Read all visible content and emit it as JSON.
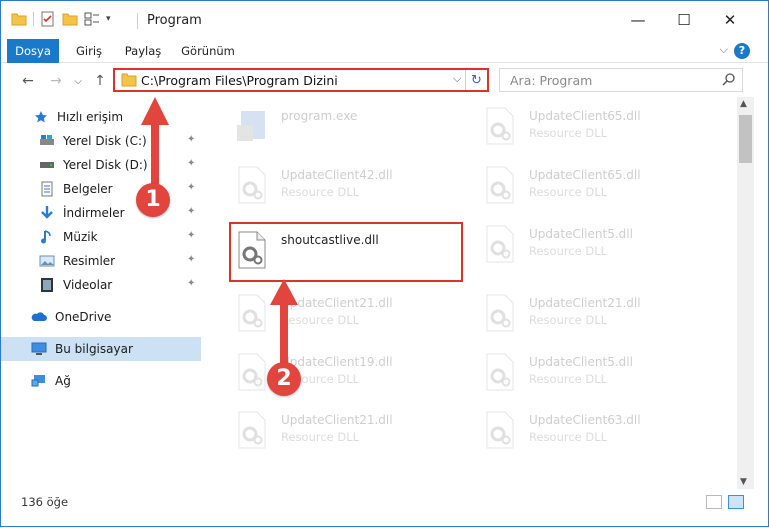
{
  "window": {
    "title": "Program",
    "controls": {
      "minimize": "—",
      "maximize": "☐",
      "close": "✕"
    }
  },
  "ribbon": {
    "tabs": [
      "Dosya",
      "Giriş",
      "Paylaş",
      "Görünüm"
    ],
    "help": "?"
  },
  "address": {
    "path": "C:\\Program Files\\Program Dizini",
    "dropdown": "⌵",
    "refresh": "↻"
  },
  "search": {
    "placeholder": "Ara: Program"
  },
  "nav": {
    "back": "←",
    "forward": "→",
    "down": "⌵",
    "up": "↑",
    "items": [
      {
        "label": "Hızlı erişim",
        "icon": "star-icon"
      },
      {
        "label": "Yerel Disk (C:)",
        "icon": "disk-icon",
        "pinned": true
      },
      {
        "label": "Yerel Disk (D:)",
        "icon": "disk-icon",
        "pinned": true
      },
      {
        "label": "Belgeler",
        "icon": "documents-icon",
        "pinned": true
      },
      {
        "label": "İndirmeler",
        "icon": "downloads-icon",
        "pinned": true
      },
      {
        "label": "Müzik",
        "icon": "music-icon",
        "pinned": true
      },
      {
        "label": "Resimler",
        "icon": "pictures-icon",
        "pinned": true
      },
      {
        "label": "Videolar",
        "icon": "videos-icon",
        "pinned": true
      },
      {
        "label": "OneDrive",
        "icon": "cloud-icon"
      },
      {
        "label": "Bu bilgisayar",
        "icon": "computer-icon"
      },
      {
        "label": "Ağ",
        "icon": "network-icon"
      }
    ],
    "pin": "✦"
  },
  "files": {
    "left": [
      {
        "name": "program.exe",
        "type": ""
      },
      {
        "name": "UpdateClient42.dll",
        "type": "Resource DLL"
      },
      {
        "name": "shoutcastlive.dll",
        "type": ""
      },
      {
        "name": "UpdateClient21.dll",
        "type": "Resource DLL"
      },
      {
        "name": "UpdateClient19.dll",
        "type": "Resource DLL"
      },
      {
        "name": "UpdateClient21.dll",
        "type": "Resource DLL"
      }
    ],
    "right": [
      {
        "name": "UpdateClient65.dll",
        "type": "Resource DLL"
      },
      {
        "name": "UpdateClient65.dll",
        "type": "Resource DLL"
      },
      {
        "name": "UpdateClient5.dll",
        "type": "Resource DLL"
      },
      {
        "name": "UpdateClient21.dll",
        "type": "Resource DLL"
      },
      {
        "name": "UpdateClient5.dll",
        "type": "Resource DLL"
      },
      {
        "name": "UpdateClient63.dll",
        "type": "Resource DLL"
      }
    ]
  },
  "status": {
    "count": "136 öğe"
  },
  "annotations": {
    "step1": "1",
    "step2": "2",
    "arrow_color": "#e2443e"
  },
  "colors": {
    "accent": "#1979ca",
    "highlight": "#d9342b",
    "selected_bg": "#cce1f4"
  }
}
